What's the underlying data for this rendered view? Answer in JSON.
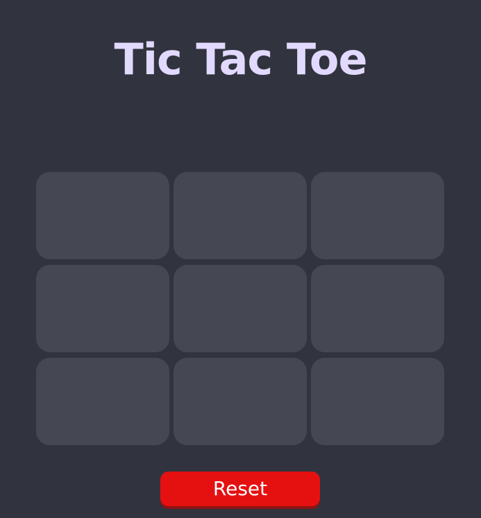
{
  "title": "Tic Tac Toe",
  "board": {
    "cells": [
      "",
      "",
      "",
      "",
      "",
      "",
      "",
      "",
      ""
    ]
  },
  "reset_label": "Reset",
  "colors": {
    "background": "#31343e",
    "title": "#e2d9ff",
    "cell": "#454852",
    "reset": "#e51111"
  }
}
